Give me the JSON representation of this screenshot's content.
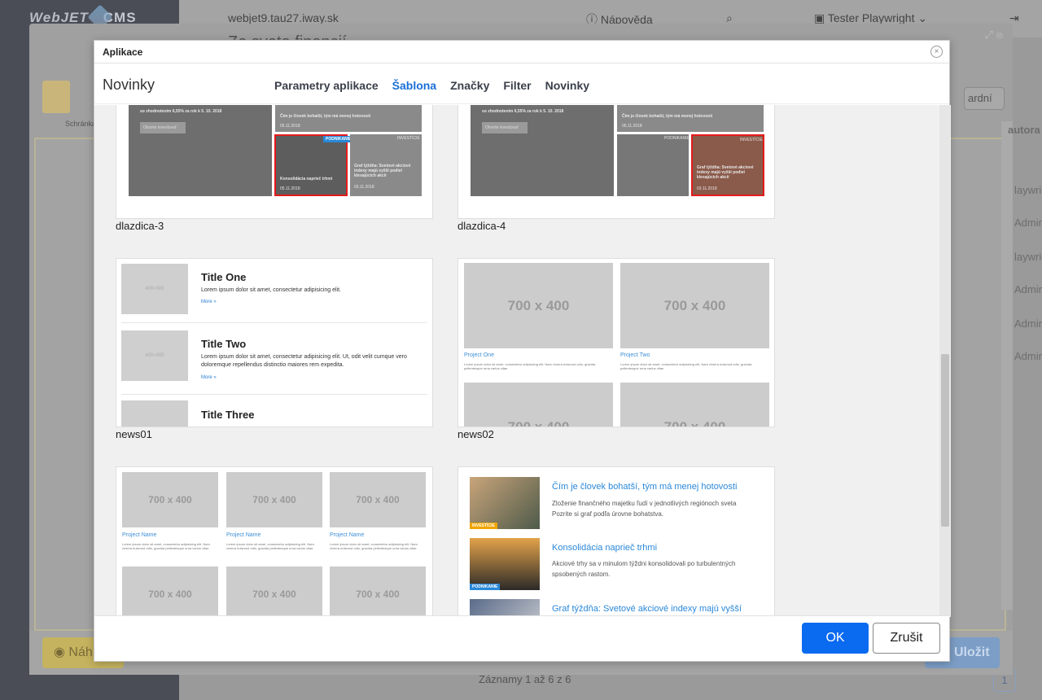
{
  "background": {
    "logo_web": "WebJET",
    "logo_cms": "CMS",
    "domain": "webjet9.tau27.iway.sk",
    "help_label": "Nápověda",
    "user_label": "Tester Playwright",
    "page_title": "Ze sveta financií",
    "clipboard_label": "Schránka",
    "select_value": "ardní",
    "col_header": "autora",
    "right_col_items": [
      "laywrig",
      "Admin",
      "laywrig",
      "Admin",
      "Admin",
      "Admin"
    ],
    "preview_button": "Náh",
    "save_button": "Uložit",
    "records_text": "Záznamy 1 až 6 z 6",
    "page_number": "1"
  },
  "modal": {
    "title": "Aplikace",
    "app_name": "Novinky",
    "tabs": [
      {
        "label": "Parametry aplikace",
        "active": false
      },
      {
        "label": "Šablona",
        "active": true
      },
      {
        "label": "Značky",
        "active": false
      },
      {
        "label": "Filter",
        "active": false
      },
      {
        "label": "Novinky",
        "active": false
      }
    ],
    "ok_label": "OK",
    "cancel_label": "Zrušit"
  },
  "templates": [
    {
      "name": "dlazdica-3",
      "top_text": "so zhodnotením 6,55% za rok k 5. 10. 2018",
      "button_text": "Otvorte investovať",
      "c1_title": "Čím je človek bohatší, tým má menej hotovosti",
      "c1_date": "05.11.2018",
      "c2_badge": "PODNIKANIE",
      "c2_title": "Konsolidácia naprieč trhmi",
      "c2_date": "05.11.2018",
      "c3_badge": "INVESTÍCIE",
      "c3_title": "Graf týždňa: Svetové akciové indexy majú vyšší podiel klesajúcich akcií",
      "c3_date": "03.11.2018"
    },
    {
      "name": "dlazdica-4",
      "top_text": "so zhodnotením 6,55% za rok k 5. 10. 2018",
      "button_text": "Otvorte investovať",
      "c1_title": "Čím je človek bohatší, tým má menej hotovosti",
      "c1_date": "05.11.2018",
      "c2_badge": "PODNIKANIE",
      "c3_badge": "INVESTÍCIE",
      "c3_title": "Graf týždňa: Svetové akciové indexy majú vyšší podiel klesajúcich akcií",
      "c3_date": "03.11.2018"
    },
    {
      "name": "news01",
      "img_text": "400×300",
      "items": [
        {
          "title": "Title One",
          "text": "Lorem ipsum dolor sit amet, consectetur adipisicing elit.",
          "more": "More »"
        },
        {
          "title": "Title Two",
          "text": "Lorem ipsum dolor sit amet, consectetur adipisicing elit. Ut, odit velit cumque vero doloremque repellendus distinctio maiores rem expedita.",
          "more": "More »"
        },
        {
          "title": "Title Three",
          "text": "",
          "more": ""
        }
      ]
    },
    {
      "name": "news02",
      "img_text": "700 x 400",
      "items": [
        {
          "title": "Project One",
          "text": "Lorem ipsum dolor sit amet, consectetur adipisicing elit. Nam viverra euismod odio, gravida pellentesque urna varius vitae."
        },
        {
          "title": "Project Two",
          "text": "Lorem ipsum dolor sit amet, consectetur adipisicing elit. Nam viverra euismod odio, gravida pellentesque urna varius vitae."
        }
      ]
    },
    {
      "name": "",
      "img_text": "700 x 400",
      "label": "Project Name",
      "text": "Lorem ipsum dolor sit amet, consectetur adipisicing elit. Nam viverra euismod odio, gravida pellentesque urna varius vitae."
    },
    {
      "name": "",
      "items": [
        {
          "title": "Čím je človek bohatší, tým má menej hotovosti",
          "text": "Zloženie finančného majetku ľudí v jednotlivých regiónoch sveta Pozrite si graf podľa úrovne bohatstva.",
          "badge": "INVESTÍCIE"
        },
        {
          "title": "Konsolidácia naprieč trhmi",
          "text": "Akciové trhy sa v minulom týždni konsolidovali po turbulentných spsobených rastom.",
          "badge": "PODNIKANIE"
        },
        {
          "title": "Graf týždňa: Svetové akciové indexy majú vyšší",
          "text": "",
          "badge": ""
        }
      ]
    }
  ],
  "colors": {
    "accent": "#1a6fd6",
    "ok_button": "#0a6af0",
    "highlight_border": "#e41b1b"
  }
}
